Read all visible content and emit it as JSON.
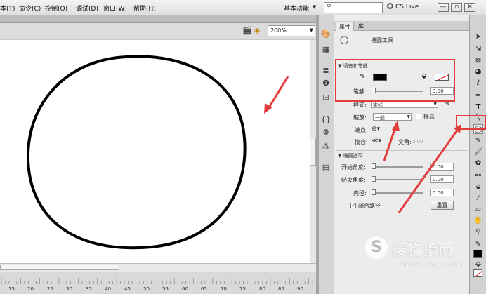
{
  "menu": {
    "items": [
      "本(T)",
      "命令(C)",
      "控制(O)",
      "调试(D)",
      "窗口(W)",
      "帮助(H)"
    ],
    "workspace": "基本功能",
    "search_placeholder": "",
    "cs_live": "CS Live",
    "window_buttons": [
      "—",
      "▫",
      "✕"
    ]
  },
  "stage": {
    "zoom": "200%",
    "timeline_ticks": [
      "15",
      "20",
      "25",
      "30",
      "35",
      "40",
      "45",
      "50",
      "55",
      "60",
      "65",
      "70",
      "75",
      "80",
      "85",
      "90"
    ]
  },
  "panel": {
    "tabs": [
      "属性",
      "库"
    ],
    "tool_name": "椭圆工具",
    "fill_stroke": {
      "header": "填充和笔触",
      "stroke_label": "笔触:",
      "stroke_value": "3.00",
      "stroke_color": "#000000",
      "style_label": "样式:",
      "style_value": "实线",
      "scale_label": "缩放:",
      "scale_value": "一般",
      "hint_label": "提示",
      "cap_label": "端点:",
      "join_label": "接合:",
      "miter_label": "尖角:",
      "miter_value": "3.00"
    },
    "ellipse_options": {
      "header": "椭圆选项",
      "start_angle_label": "开始角度:",
      "start_angle_value": "0.00",
      "end_angle_label": "结束角度:",
      "end_angle_value": "0.00",
      "inner_radius_label": "内径:",
      "inner_radius_value": "0.00",
      "close_path_label": "闭合路径",
      "reset_label": "重置"
    }
  },
  "watermark": {
    "brand": "搜狗指南",
    "url": "zhinan.sogou.com"
  },
  "colors": {
    "annotation": "#e23c3c",
    "ellipse_stroke": "#000000",
    "canvas": "#ffffff"
  }
}
